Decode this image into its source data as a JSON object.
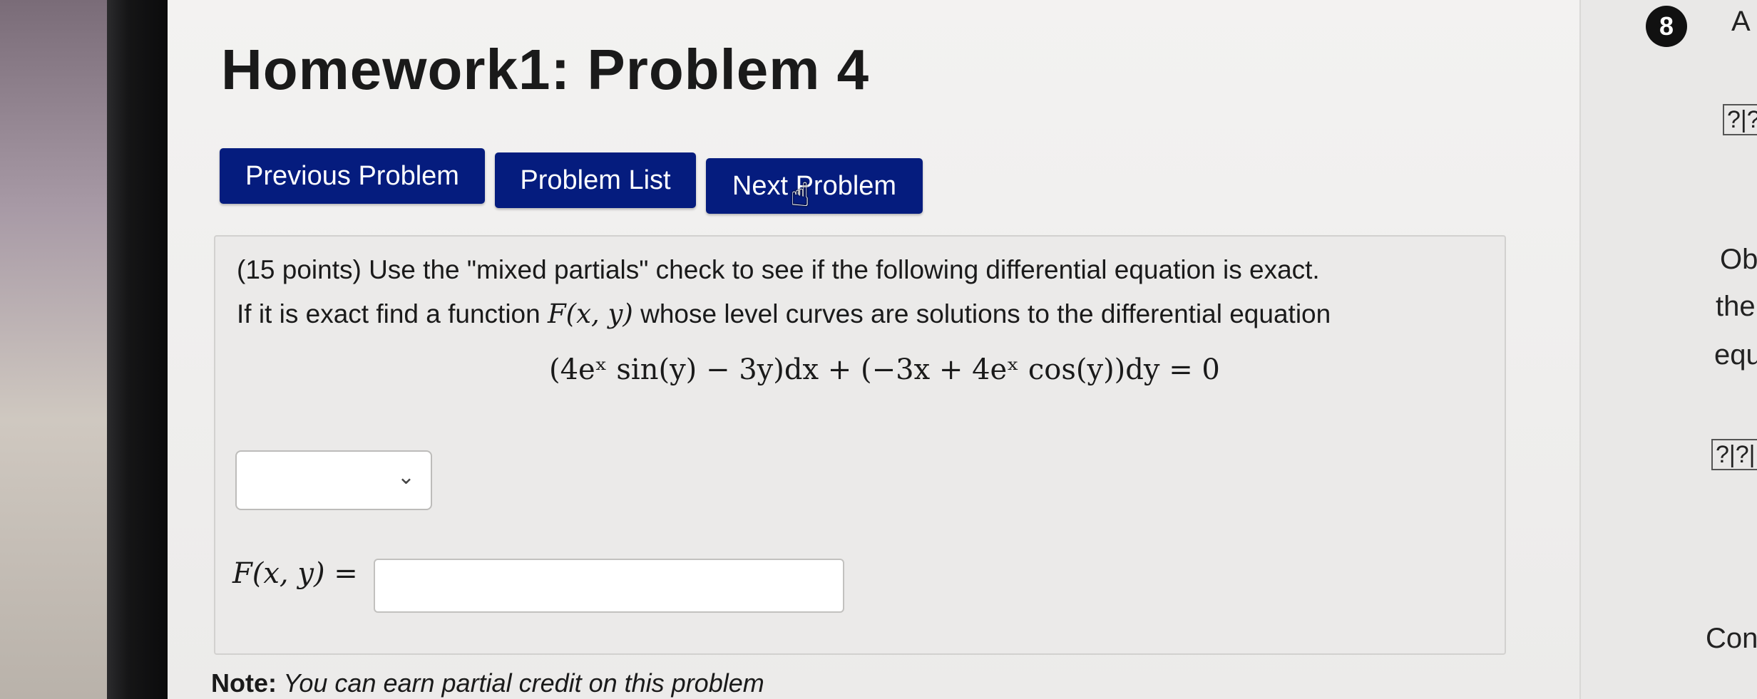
{
  "page": {
    "title": "Homework1: Problem 4"
  },
  "nav": {
    "previous": "Previous Problem",
    "list": "Problem List",
    "next": "Next Problem"
  },
  "problem": {
    "intro": "(15 points) Use the \"mixed partials\" check to see if the following differential equation is exact.",
    "line2_prefix": "If it is exact find a function ",
    "function_name": "F(x, y)",
    "line2_suffix": " whose level curves are solutions to the differential equation",
    "equation": "(4eˣ sin(y) − 3y)dx + (−3x + 4eˣ cos(y))dy = 0"
  },
  "exact_select": {
    "selected": ""
  },
  "answer": {
    "label": "F(x, y) =",
    "value": ""
  },
  "note": {
    "bold": "Note:",
    "text": " You can earn partial credit on this problem"
  },
  "right_pane": {
    "badge": "8",
    "letter": "A",
    "box1": "?|?",
    "word1": "Ob",
    "word2": "the",
    "word3": "equ",
    "box2": "?|?|",
    "word4": "Con"
  },
  "colors": {
    "button_bg": "#051c7e",
    "button_text": "#ffffff",
    "panel_bg": "#ebeae9"
  }
}
